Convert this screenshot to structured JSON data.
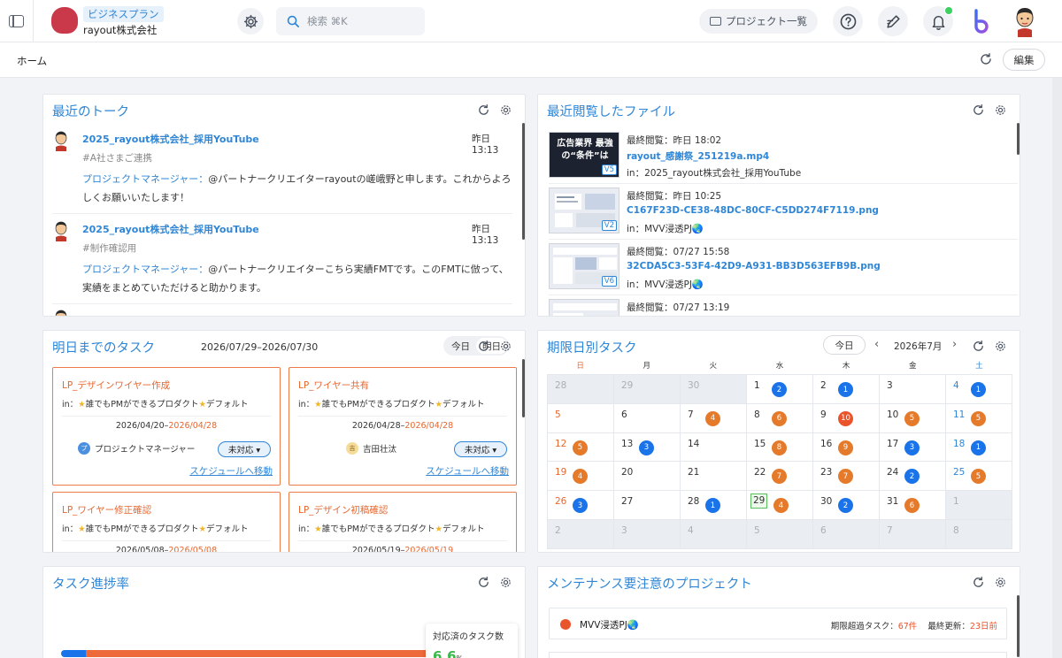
{
  "header": {
    "plan": "ビジネスプラン",
    "company": "rayout株式会社",
    "search_placeholder": "検索 ⌘K",
    "project_list": "プロジェクト一覧"
  },
  "breadcrumb": "ホーム",
  "edit_label": "編集",
  "talks": {
    "title": "最近のトーク",
    "items": [
      {
        "project": "2025_rayout株式会社_採用YouTube",
        "time": "昨日 13:13",
        "tag": "#A社さまご連携",
        "sender": "プロジェクトマネージャー：",
        "message": "@パートナークリエイターrayoutの嵯峨野と申します。これからよろしくお願いいたします！"
      },
      {
        "project": "2025_rayout株式会社_採用YouTube",
        "time": "昨日 13:13",
        "tag": "#制作確認用",
        "sender": "プロジェクトマネージャー：",
        "message": "@パートナークリエイターこちら実績FMTです。このFMTに倣って、実績をまとめていただけると助かります。"
      }
    ]
  },
  "files": {
    "title": "最近閲覧したファイル",
    "items": [
      {
        "seen": "最終閲覧：昨日 18:02",
        "name": "rayout_感謝祭_251219a.mp4",
        "in": "in：2025_rayout株式会社_採用YouTube",
        "version": "V5",
        "thumb_text": "広告業界 最強の“条件”は"
      },
      {
        "seen": "最終閲覧：昨日 10:25",
        "name": "C167F23D-CE38-48DC-80CF-C5DD274F7119.png",
        "in": "in：MVV浸透PJ🌏",
        "version": "V2"
      },
      {
        "seen": "最終閲覧：07/27 15:58",
        "name": "32CDA5C3-53F4-42D9-A931-BB3D563EFB9B.png",
        "in": "in：MVV浸透PJ🌏",
        "version": "V6"
      },
      {
        "seen": "最終閲覧：07/27 13:19",
        "name": "",
        "in": "",
        "version": ""
      }
    ]
  },
  "tasks": {
    "title": "明日までのタスク",
    "range": "2026/07/29–2026/07/30",
    "tab_today": "今日",
    "tab_tomorrow": "明日",
    "items": [
      {
        "title": "LP_デザインワイヤー作成",
        "in_prefix": "in：",
        "in_project": "誰でもPMができるプロダクト",
        "in_suffix": "デフォルト",
        "start": "2026/04/20–",
        "due": "2026/04/28",
        "assignee": "プロジェクトマネージャー",
        "assignee_initial": "プ",
        "status": "未対応 ▾",
        "link": "スケジュールへ移動"
      },
      {
        "title": "LP_ワイヤー共有",
        "in_prefix": "in：",
        "in_project": "誰でもPMができるプロダクト",
        "in_suffix": "デフォルト",
        "start": "2026/04/28–",
        "due": "2026/04/28",
        "assignee": "吉田壮汰",
        "assignee_initial": "吉",
        "status": "未対応 ▾",
        "link": "スケジュールへ移動"
      },
      {
        "title": "LP_ワイヤー修正確認",
        "in_prefix": "in：",
        "in_project": "誰でもPMができるプロダクト",
        "in_suffix": "デフォルト",
        "start": "2026/05/08–",
        "due": "2026/05/08"
      },
      {
        "title": "LP_デザイン初稿確認",
        "in_prefix": "in：",
        "in_project": "誰でもPMができるプロダクト",
        "in_suffix": "デフォルト",
        "start": "2026/05/19–",
        "due": "2026/05/19"
      }
    ]
  },
  "calendar": {
    "title": "期限日別タスク",
    "today_btn": "今日",
    "month": "2026年7月",
    "weekdays": [
      "日",
      "月",
      "火",
      "水",
      "木",
      "金",
      "土"
    ],
    "today_day": 29,
    "days": [
      {
        "d": "28",
        "out": true
      },
      {
        "d": "29",
        "out": true
      },
      {
        "d": "30",
        "out": true
      },
      {
        "d": "1",
        "n": 2,
        "c": "b"
      },
      {
        "d": "2",
        "n": 1,
        "c": "b"
      },
      {
        "d": "3"
      },
      {
        "d": "4",
        "n": 1,
        "c": "b"
      },
      {
        "d": "5"
      },
      {
        "d": "6"
      },
      {
        "d": "7",
        "n": 4,
        "c": "o"
      },
      {
        "d": "8",
        "n": 6,
        "c": "o"
      },
      {
        "d": "9",
        "n": 10,
        "c": "r"
      },
      {
        "d": "10",
        "n": 5,
        "c": "o"
      },
      {
        "d": "11",
        "n": 5,
        "c": "o"
      },
      {
        "d": "12",
        "n": 5,
        "c": "o"
      },
      {
        "d": "13",
        "n": 3,
        "c": "b"
      },
      {
        "d": "14"
      },
      {
        "d": "15",
        "n": 8,
        "c": "o"
      },
      {
        "d": "16",
        "n": 9,
        "c": "o"
      },
      {
        "d": "17",
        "n": 3,
        "c": "b"
      },
      {
        "d": "18",
        "n": 1,
        "c": "b"
      },
      {
        "d": "19",
        "n": 4,
        "c": "o"
      },
      {
        "d": "20"
      },
      {
        "d": "21"
      },
      {
        "d": "22",
        "n": 7,
        "c": "o"
      },
      {
        "d": "23",
        "n": 7,
        "c": "o"
      },
      {
        "d": "24",
        "n": 2,
        "c": "b"
      },
      {
        "d": "25",
        "n": 5,
        "c": "o"
      },
      {
        "d": "26",
        "n": 3,
        "c": "b"
      },
      {
        "d": "27"
      },
      {
        "d": "28",
        "n": 1,
        "c": "b"
      },
      {
        "d": "29",
        "n": 4,
        "c": "o"
      },
      {
        "d": "30",
        "n": 2,
        "c": "b"
      },
      {
        "d": "31",
        "n": 6,
        "c": "o"
      },
      {
        "d": "1",
        "out": true
      },
      {
        "d": "2",
        "out": true
      },
      {
        "d": "3",
        "out": true
      },
      {
        "d": "4",
        "out": true
      },
      {
        "d": "5",
        "out": true
      },
      {
        "d": "6",
        "out": true
      },
      {
        "d": "7",
        "out": true
      },
      {
        "d": "8",
        "out": true
      }
    ]
  },
  "progress": {
    "title": "タスク進捗率",
    "tooltip_label": "対応済のタスク数",
    "tooltip_value": "6.6",
    "tooltip_unit": "%",
    "segments": [
      {
        "fraction": 0.055,
        "color": "#1a73e8"
      },
      {
        "fraction": 0.87,
        "color": "#ee6a3a"
      },
      {
        "fraction": 0.075,
        "color": "#3fc84a"
      }
    ]
  },
  "maintenance": {
    "title": "メンテナンス要注意のプロジェクト",
    "items": [
      {
        "project": "MVV浸透PJ🌏",
        "overdue_label": "期限超過タスク：",
        "overdue_value": "67件",
        "updated_label": "最終更新：",
        "updated_value": "23日前"
      }
    ]
  },
  "colors": {
    "accent": "#2f86d6",
    "warning": "#e7672f",
    "success": "#3bb84c"
  }
}
